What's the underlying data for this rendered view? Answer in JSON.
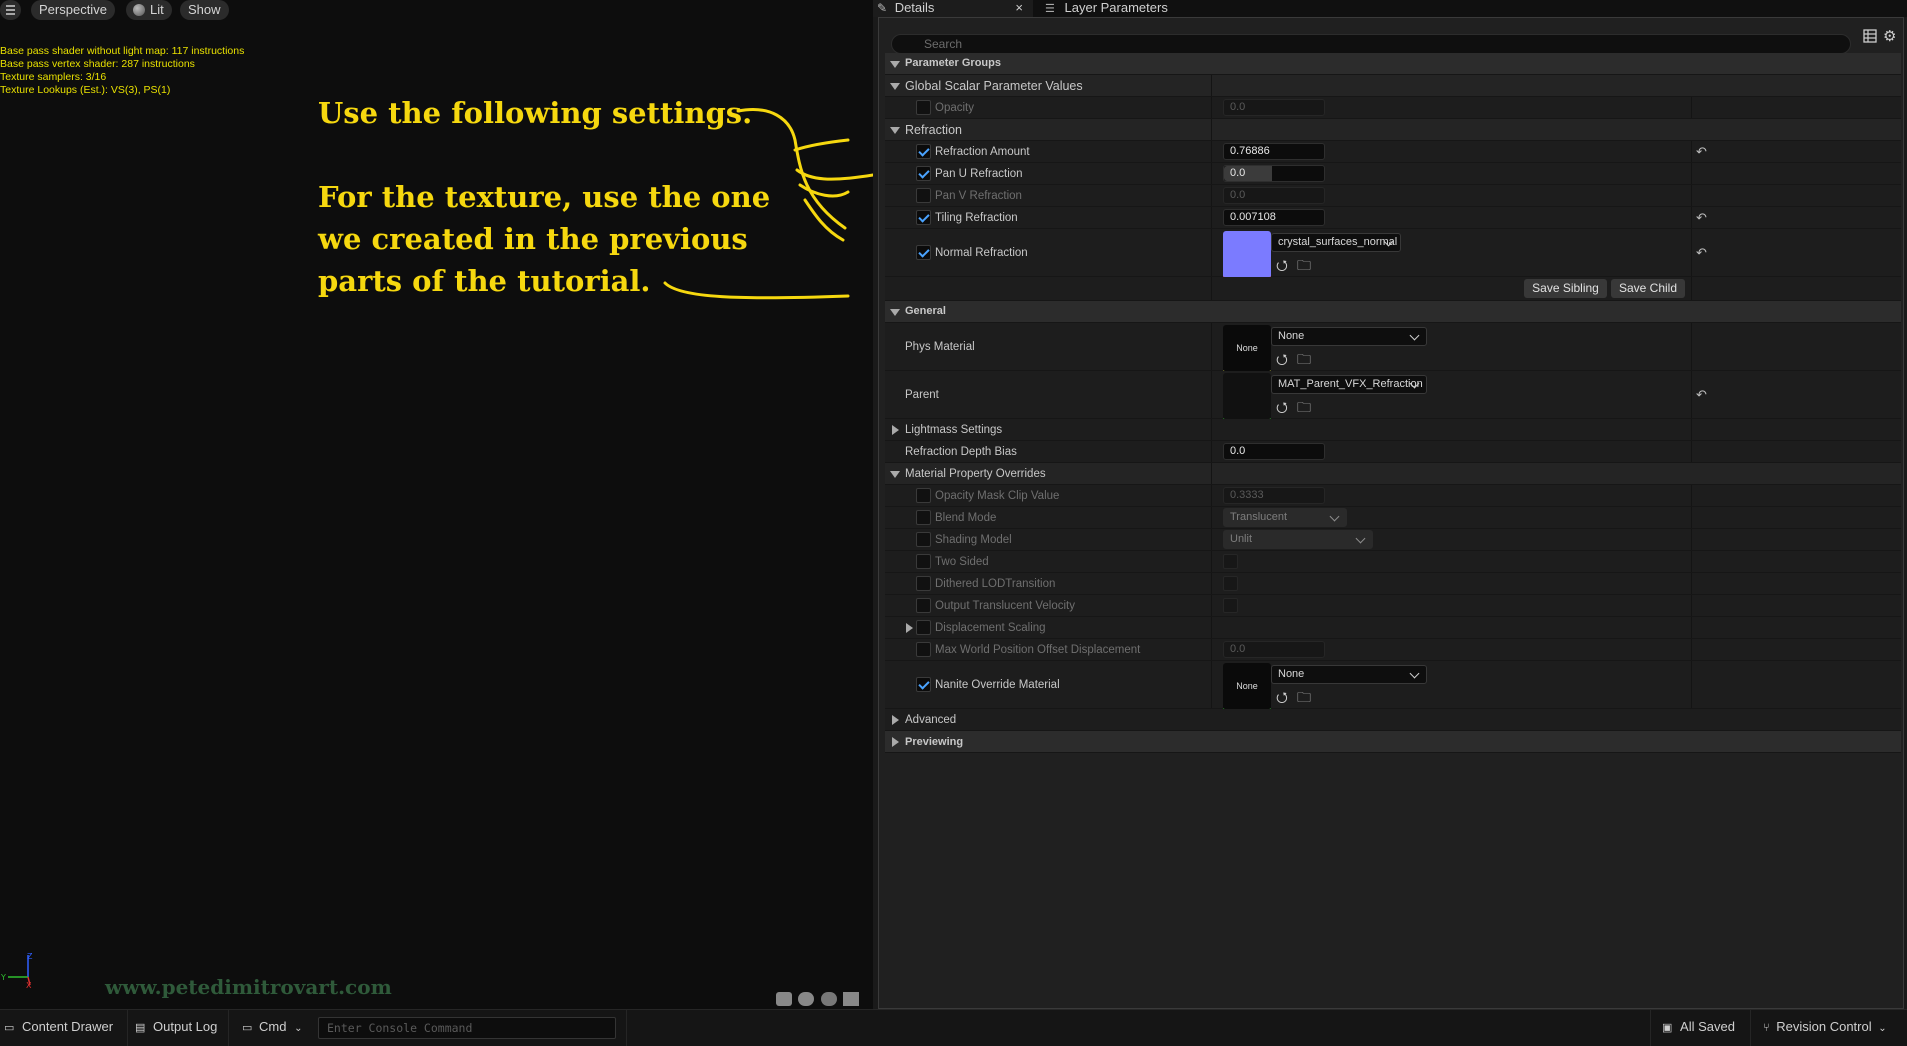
{
  "viewport": {
    "menu_icon": "hamburger-icon",
    "perspective": "Perspective",
    "lit": "Lit",
    "show": "Show",
    "stats": [
      "Base pass shader without light map: 117 instructions",
      "Base pass vertex shader: 287 instructions",
      "Texture samplers: 3/16",
      "Texture Lookups (Est.): VS(3), PS(1)"
    ],
    "annotation": {
      "line1": "Use the following settings.",
      "line2": "For the texture, use the one",
      "line3": "we created in the previous",
      "line4": "parts of the tutorial.",
      "color": "#f6d80f"
    },
    "axis": {
      "y": "Y",
      "z": "Z",
      "x": "X"
    },
    "watermark": "www.petedimitrovart.com"
  },
  "tabs": {
    "details": "Details",
    "close": "×",
    "layer_parameters": "Layer Parameters"
  },
  "search": {
    "placeholder": "Search"
  },
  "parameter_groups": {
    "title": "Parameter Groups",
    "global_scalar": {
      "title": "Global Scalar Parameter Values",
      "opacity_label": "Opacity",
      "opacity_value": "0.0"
    },
    "refraction": {
      "title": "Refraction",
      "amount_label": "Refraction Amount",
      "amount_value": "0.76886",
      "pan_u_label": "Pan U Refraction",
      "pan_u_value": "0.0",
      "pan_u_fill": 0.48,
      "pan_v_label": "Pan V Refraction",
      "pan_v_value": "0.0",
      "tiling_label": "Tiling Refraction",
      "tiling_value": "0.007108",
      "normal_label": "Normal Refraction",
      "normal_texture": "crystal_surfaces_normal",
      "normal_color": "#7b7bff"
    },
    "save_sibling": "Save Sibling",
    "save_child": "Save Child"
  },
  "general": {
    "title": "General",
    "phys_material_label": "Phys Material",
    "phys_material_thumb": "None",
    "phys_material_value": "None",
    "parent_label": "Parent",
    "parent_value": "MAT_Parent_VFX_Refraction",
    "lightmass": "Lightmass Settings",
    "depth_bias_label": "Refraction Depth Bias",
    "depth_bias_value": "0.0"
  },
  "overrides": {
    "title": "Material Property Overrides",
    "opacity_mask_label": "Opacity Mask Clip Value",
    "opacity_mask_value": "0.3333",
    "blend_mode_label": "Blend Mode",
    "blend_mode_value": "Translucent",
    "shading_model_label": "Shading Model",
    "shading_model_value": "Unlit",
    "two_sided": "Two Sided",
    "dithered": "Dithered LODTransition",
    "output_velocity": "Output Translucent Velocity",
    "displacement": "Displacement Scaling",
    "max_wpo_label": "Max World Position Offset Displacement",
    "max_wpo_value": "0.0",
    "nanite_label": "Nanite Override Material",
    "nanite_thumb": "None",
    "nanite_value": "None"
  },
  "advanced": "Advanced",
  "previewing": "Previewing",
  "statusbar": {
    "content_drawer": "Content Drawer",
    "output_log": "Output Log",
    "cmd": "Cmd",
    "console_placeholder": "Enter Console Command",
    "all_saved": "All Saved",
    "revision_control": "Revision Control"
  }
}
